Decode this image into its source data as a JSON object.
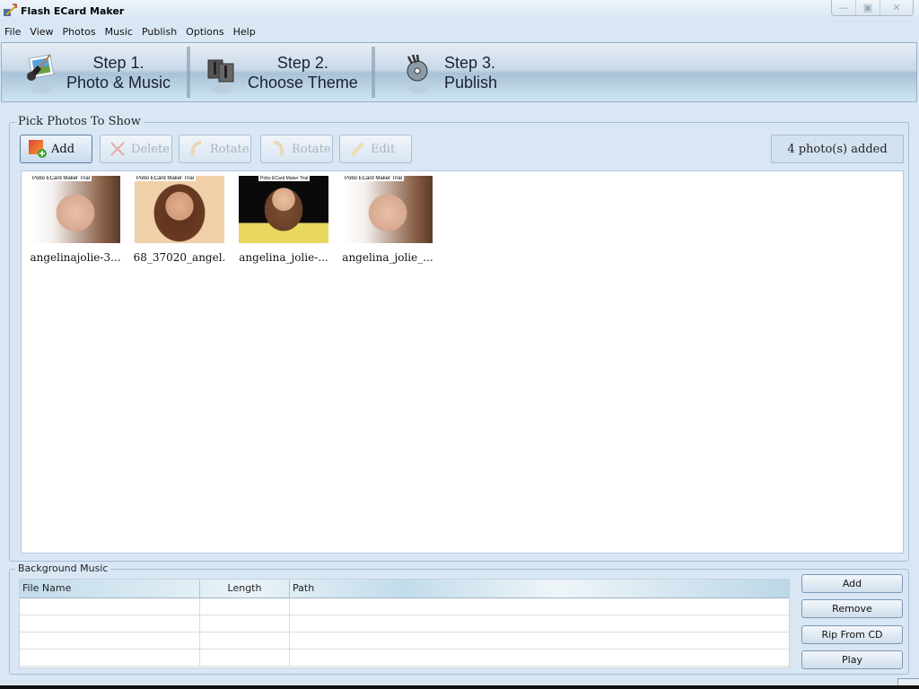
{
  "window": {
    "title": "Flash ECard Maker",
    "controls": [
      "minimize",
      "restore",
      "close"
    ]
  },
  "menu": [
    "File",
    "View",
    "Photos",
    "Music",
    "Publish",
    "Options",
    "Help"
  ],
  "steps": [
    {
      "line1": "Step 1.",
      "line2": "Photo & Music",
      "icon": "guitar-photo-icon"
    },
    {
      "line1": "Step 2.",
      "line2": "Choose Theme",
      "icon": "theme-icon"
    },
    {
      "line1": "Step 3.",
      "line2": "Publish",
      "icon": "disc-publish-icon"
    }
  ],
  "photos": {
    "group_title": "Pick Photos To Show",
    "toolbar": {
      "add": "Add",
      "delete": "Delete",
      "rotate_left": "Rotate",
      "rotate_right": "Rotate",
      "edit": "Edit"
    },
    "count_label": "4 photo(s) added",
    "items": [
      {
        "name": "angelinajolie-3...",
        "watermark": "Pobo ECard Maker Trial"
      },
      {
        "name": "68_37020_angel.",
        "watermark": "Pobo ECard Maker Trial"
      },
      {
        "name": "angelina_jolie-...",
        "watermark": "Pobo ECard Maker Trial"
      },
      {
        "name": "angelina_jolie_...",
        "watermark": "Pobo ECard Maker Trial"
      }
    ]
  },
  "music": {
    "group_title": "Background Music",
    "columns": [
      "File Name",
      "Length",
      "Path"
    ],
    "rows": [],
    "buttons": {
      "add": "Add",
      "remove": "Remove",
      "rip": "Rip From CD",
      "play": "Play"
    }
  },
  "colors": {
    "background": "#d9e7f5",
    "accent": "#5c7c9c"
  }
}
